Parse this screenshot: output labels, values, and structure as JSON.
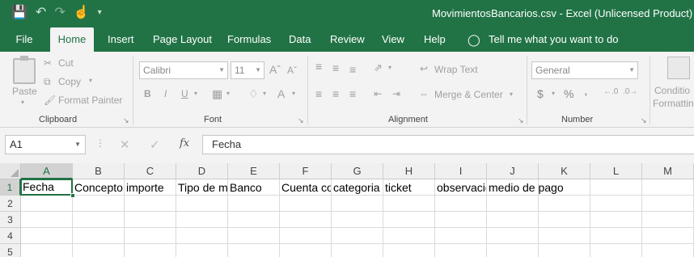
{
  "window": {
    "title": "MovimientosBancarios.csv  -  Excel (Unlicensed Product)",
    "qat_icons": [
      "save-icon",
      "undo-icon",
      "redo-icon",
      "touch-mode-icon",
      "customize-qat-icon"
    ]
  },
  "tabs": [
    {
      "label": "File"
    },
    {
      "label": "Home"
    },
    {
      "label": "Insert"
    },
    {
      "label": "Page Layout"
    },
    {
      "label": "Formulas"
    },
    {
      "label": "Data"
    },
    {
      "label": "Review"
    },
    {
      "label": "View"
    },
    {
      "label": "Help"
    }
  ],
  "active_tab": "Home",
  "tell_me": "Tell me what you want to do",
  "ribbon": {
    "clipboard": {
      "label": "Clipboard",
      "paste": "Paste",
      "cut": "Cut",
      "copy": "Copy",
      "format_painter": "Format Painter"
    },
    "font": {
      "label": "Font",
      "font_name": "Calibri",
      "font_size": "11",
      "bold": "B",
      "italic": "I",
      "underline": "U"
    },
    "alignment": {
      "label": "Alignment",
      "wrap_text": "Wrap Text",
      "merge_center": "Merge & Center"
    },
    "number": {
      "label": "Number",
      "format": "General",
      "currency": "$",
      "percent": "%",
      "comma": ","
    },
    "styles": {
      "conditional": "Conditio",
      "formatting": "Formattin"
    }
  },
  "formula_bar": {
    "name_box": "A1",
    "fx": "fx",
    "value": "Fecha"
  },
  "sheet": {
    "columns": [
      "A",
      "B",
      "C",
      "D",
      "E",
      "F",
      "G",
      "H",
      "I",
      "J",
      "K",
      "L",
      "M"
    ],
    "rows": [
      "1",
      "2",
      "3",
      "4",
      "5"
    ],
    "row1": [
      "Fecha",
      "Concepto",
      "importe",
      "Tipo de m",
      "Banco",
      "Cuenta co",
      "categoria",
      "ticket",
      "observacio",
      "medio de pago",
      "",
      "",
      ""
    ],
    "active_cell": "A1"
  },
  "colors": {
    "accent": "#217346",
    "ribbon_bg": "#f3f3f3"
  }
}
